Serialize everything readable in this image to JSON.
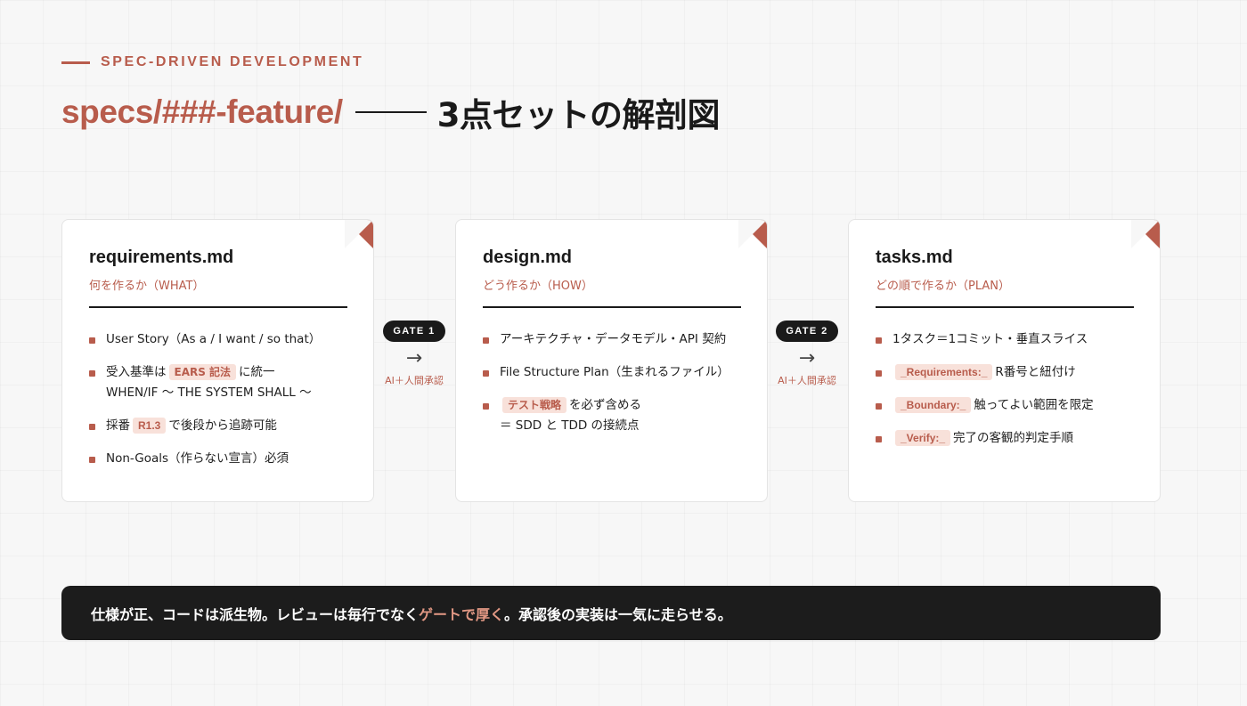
{
  "header": {
    "eyebrow": "SPEC-DRIVEN DEVELOPMENT",
    "title_path": "specs/###-feature/",
    "title_main": "3点セットの解剖図"
  },
  "cards": [
    {
      "title": "requirements.md",
      "subtitle": "何を作るか（WHAT）",
      "items": [
        {
          "text": "User Story（As a / I want / so that）"
        },
        {
          "pre": "受入基準は",
          "tag": "EARS 記法",
          "post": "に統一",
          "line2": "WHEN/IF 〜 THE SYSTEM SHALL 〜"
        },
        {
          "pre": "採番",
          "tag": "R1.3",
          "post": "で後段から追跡可能"
        },
        {
          "text": "Non-Goals（作らない宣言）必須"
        }
      ]
    },
    {
      "title": "design.md",
      "subtitle": "どう作るか（HOW）",
      "items": [
        {
          "text": "アーキテクチャ・データモデル・API 契約"
        },
        {
          "text": "File Structure Plan（生まれるファイル）"
        },
        {
          "tag": "テスト戦略",
          "post": "を必ず含める",
          "line2": "＝ SDD と TDD の接続点"
        }
      ]
    },
    {
      "title": "tasks.md",
      "subtitle": "どの順で作るか（PLAN）",
      "items": [
        {
          "text": "1タスク＝1コミット・垂直スライス"
        },
        {
          "tag": "_Requirements:_",
          "post": "R番号と紐付け"
        },
        {
          "tag": "_Boundary:_",
          "post": "触ってよい範囲を限定"
        },
        {
          "tag": "_Verify:_",
          "post": "完了の客観的判定手順"
        }
      ]
    }
  ],
  "gates": [
    {
      "label": "GATE 1",
      "arrow": "→",
      "note": "AI＋人間承認"
    },
    {
      "label": "GATE 2",
      "arrow": "→",
      "note": "AI＋人間承認"
    }
  ],
  "banner": {
    "part1": "仕様が正、コードは派生物。レビューは毎行でなく",
    "highlight": "ゲートで厚く",
    "part2": "。承認後の実装は一気に走らせる。"
  },
  "colors": {
    "accent": "#b85c4c",
    "dark": "#1a1a1a",
    "tag_bg": "#f8e1da",
    "banner_highlight": "#e29884"
  },
  "icons": {
    "card_corner": "folded-corner-icon",
    "bullet": "square-bullet-icon",
    "gate_arrow": "right-arrow-icon"
  }
}
